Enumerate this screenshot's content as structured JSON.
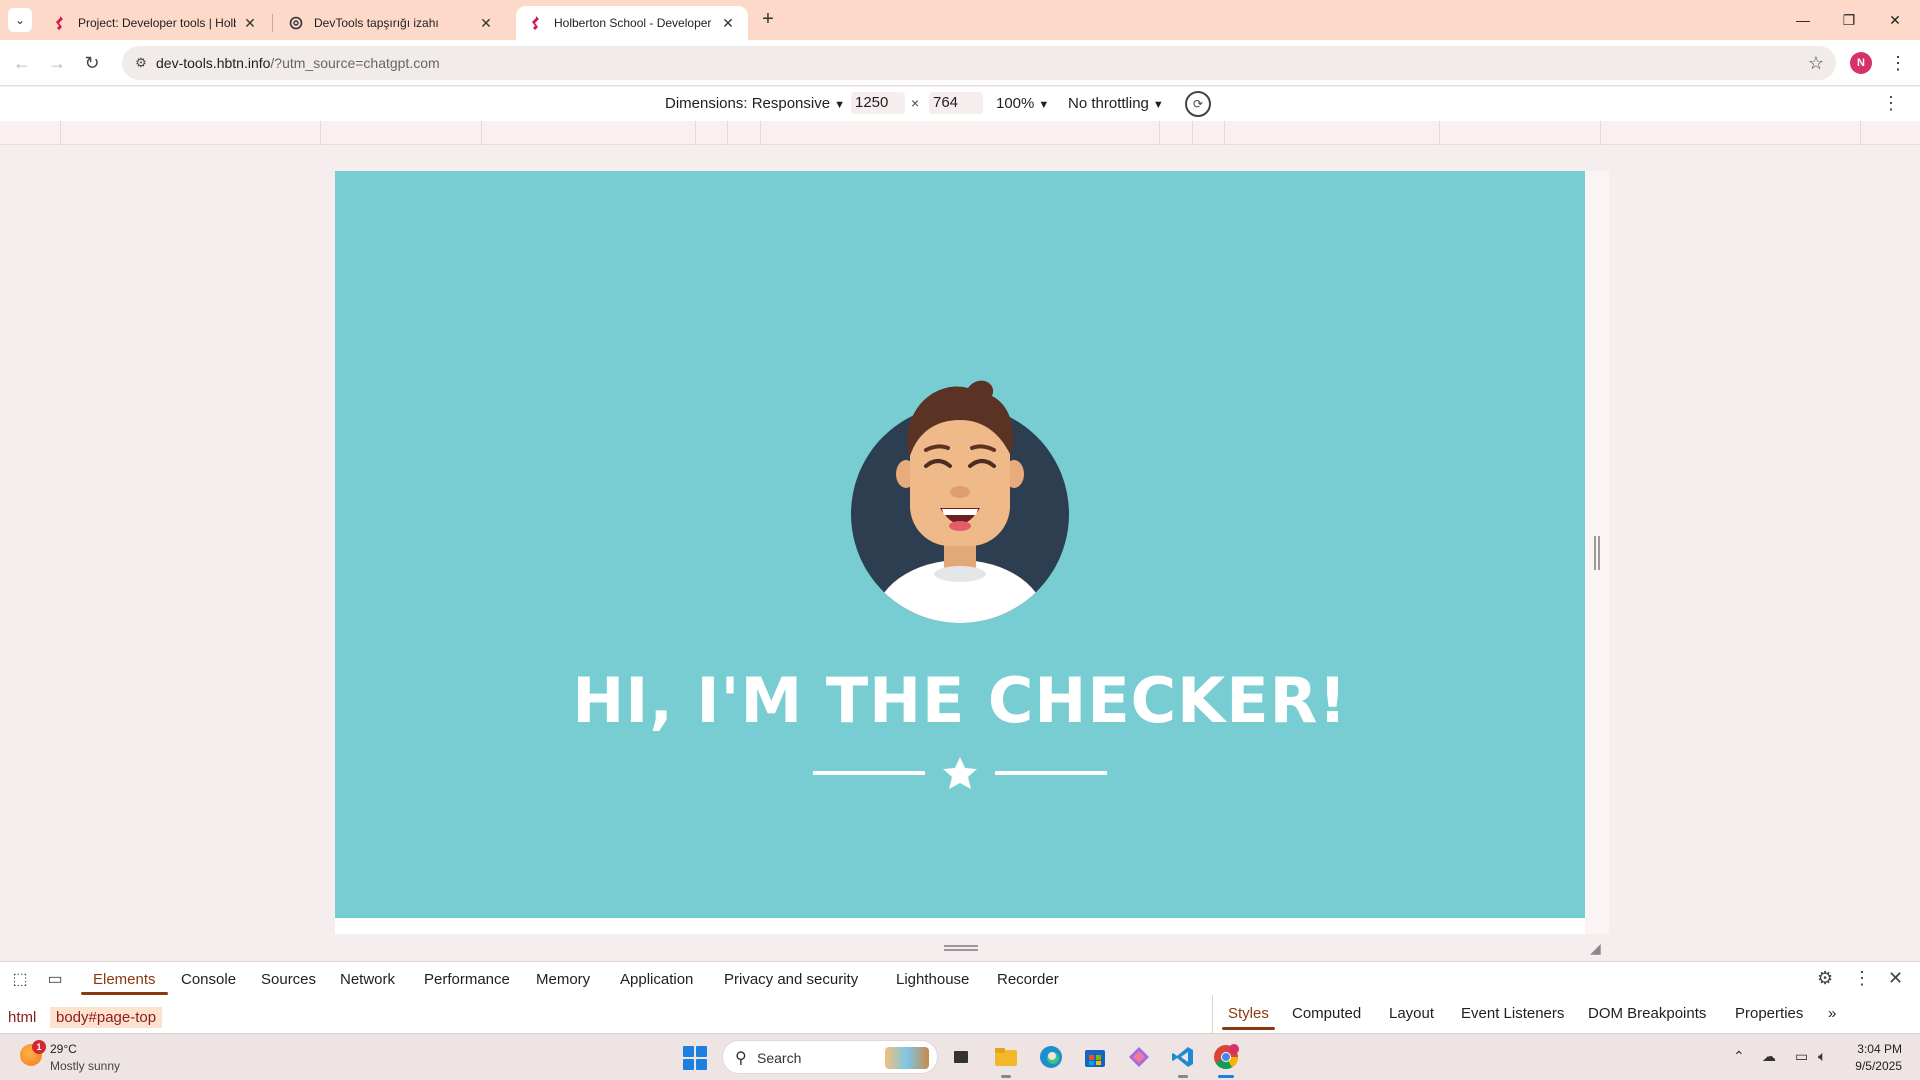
{
  "browser": {
    "tabs": [
      {
        "title": "Project: Developer tools | Holbe",
        "close": "✕"
      },
      {
        "title": "DevTools tapşırığı izahı",
        "close": "✕"
      },
      {
        "title": "Holberton School - Developer t",
        "close": "✕"
      }
    ],
    "new_tab": "+",
    "address": {
      "host": "dev-tools.hbtn.info",
      "path": "/?utm_source=chatgpt.com"
    },
    "profile_initial": "N"
  },
  "device_toolbar": {
    "dimensions_label": "Dimensions: Responsive",
    "width": "1250",
    "height": "764",
    "times": "×",
    "zoom": "100%",
    "throttling": "No throttling"
  },
  "page": {
    "hero_title": "HI, I'M THE CHECKER!",
    "colors": {
      "background": "#77cdd2",
      "text": "#ffffff",
      "avatar_circle": "#2c3e50",
      "hair": "#5a3325",
      "skin": "#efb98a"
    }
  },
  "devtools": {
    "tabs": [
      "Elements",
      "Console",
      "Sources",
      "Network",
      "Performance",
      "Memory",
      "Application",
      "Privacy and security",
      "Lighthouse",
      "Recorder"
    ],
    "active_tab": "Elements",
    "breadcrumbs": [
      "html",
      "body#page-top"
    ],
    "side_tabs": [
      "Styles",
      "Computed",
      "Layout",
      "Event Listeners",
      "DOM Breakpoints",
      "Properties"
    ],
    "active_side_tab": "Styles",
    "more": "»"
  },
  "taskbar": {
    "weather_badge": "1",
    "temperature": "29°C",
    "weather_desc": "Mostly sunny",
    "search_label": "Search",
    "time": "3:04 PM",
    "date": "9/5/2025"
  }
}
